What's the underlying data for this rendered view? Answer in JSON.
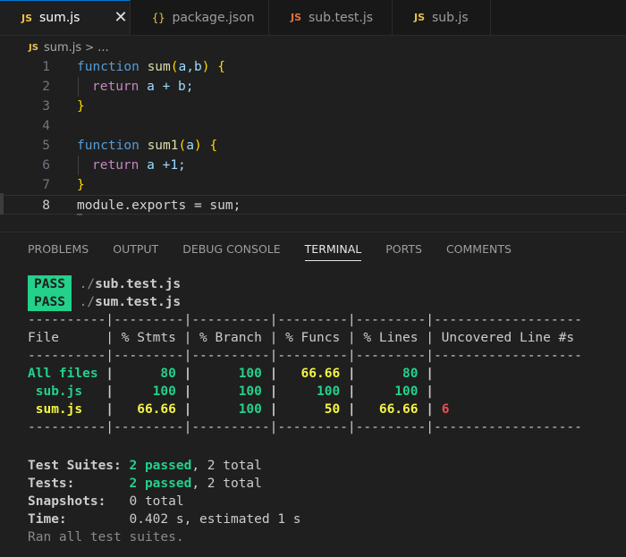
{
  "tabs": [
    {
      "icon": "JS",
      "label": "sum.js",
      "close": "✕"
    },
    {
      "icon": "{}",
      "label": "package.json"
    },
    {
      "icon": "JS",
      "label": "sub.test.js"
    },
    {
      "icon": "JS",
      "label": "sub.js"
    }
  ],
  "breadcrumb": {
    "icon": "JS",
    "file": "sum.js",
    "sep": ">",
    "rest": "..."
  },
  "editor": {
    "line_numbers": [
      "1",
      "2",
      "3",
      "4",
      "5",
      "6",
      "7",
      "8"
    ],
    "code": {
      "l1": {
        "kw": "function",
        "name": "sum",
        "open": "(",
        "args": "a,b",
        "close": ")",
        "brace": "{"
      },
      "l2": {
        "ret": "return",
        "expr": "a + b;"
      },
      "l3": {
        "brace": "}"
      },
      "l5": {
        "kw": "function",
        "name": "sum1",
        "open": "(",
        "args": "a",
        "close": ")",
        "brace": "{"
      },
      "l6": {
        "ret": "return",
        "expr": "a +1;"
      },
      "l7": {
        "brace": "}"
      },
      "l8": {
        "text": "module.exports = sum;"
      }
    }
  },
  "panel": {
    "tabs": [
      "PROBLEMS",
      "OUTPUT",
      "DEBUG CONSOLE",
      "TERMINAL",
      "PORTS",
      "COMMENTS"
    ],
    "active_tab": "TERMINAL"
  },
  "terminal": {
    "pass_label": "PASS",
    "results": [
      {
        "dir": "./",
        "file": "sub.test.js"
      },
      {
        "dir": "./",
        "file": "sum.test.js"
      }
    ],
    "separator": "----------|---------|----------|---------|---------|-------------------",
    "header": "File      | % Stmts | % Branch | % Funcs | % Lines | Uncovered Line #s ",
    "coverage_rows": [
      {
        "file": "All files",
        "stmts": "80",
        "branch": "100",
        "funcs": "66.66",
        "lines": "80",
        "uncovered": ""
      },
      {
        "file": " sub.js",
        "stmts": "100",
        "branch": "100",
        "funcs": "100",
        "lines": "100",
        "uncovered": ""
      },
      {
        "file": " sum.js",
        "stmts": "66.66",
        "branch": "100",
        "funcs": "50",
        "lines": "66.66",
        "uncovered": "6"
      }
    ],
    "summary": {
      "suites_label": "Test Suites:",
      "suites_passed": "2 passed",
      "suites_total": ", 2 total",
      "tests_label": "Tests:",
      "tests_passed": "2 passed",
      "tests_total": ", 2 total",
      "snap_label": "Snapshots:",
      "snap_value": "0 total",
      "time_label": "Time:",
      "time_value": "0.402 s, estimated 1 s",
      "footer": "Ran all test suites."
    }
  },
  "colors": {
    "pass_green": "#23d18b",
    "warn_yellow": "#f5f543",
    "error_red": "#f14c4c",
    "accent": "#0078d4"
  }
}
